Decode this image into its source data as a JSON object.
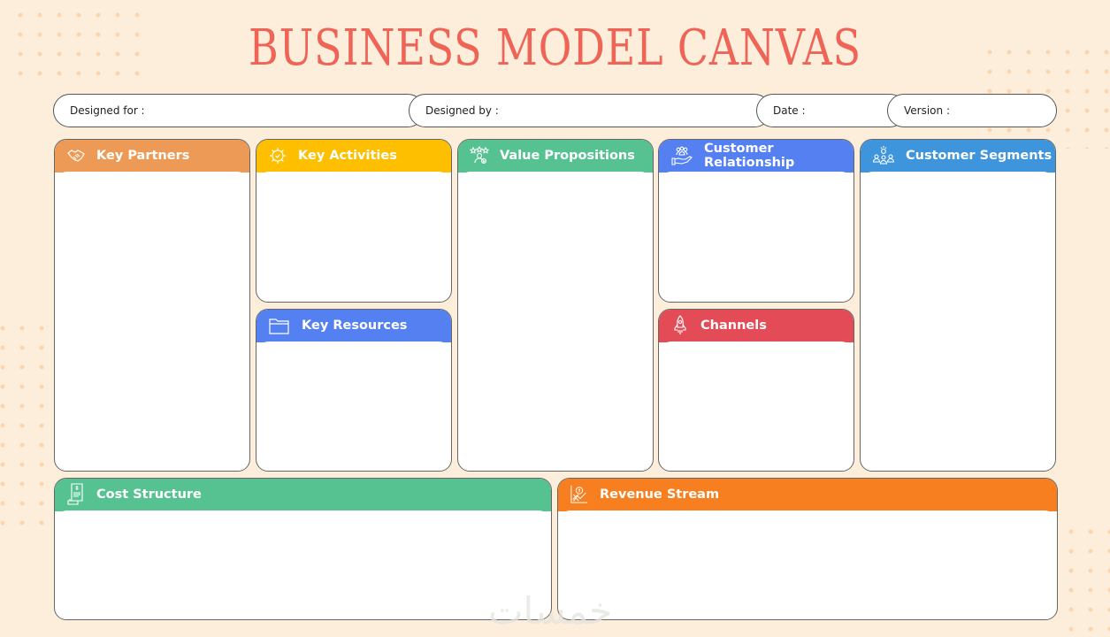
{
  "title": "BUSINESS MODEL CANVAS",
  "meta_fields": [
    {
      "label": "Designed for :",
      "value": ""
    },
    {
      "label": "Designed by :",
      "value": ""
    },
    {
      "label": "Date :",
      "value": ""
    },
    {
      "label": "Version :",
      "value": ""
    }
  ],
  "blocks": {
    "key_partners": {
      "label": "Key Partners",
      "icon": "handshake-icon",
      "color": "#ec9a55"
    },
    "key_activities": {
      "label": "Key Activities",
      "icon": "gear-check-icon",
      "color": "#fdbf00"
    },
    "key_resources": {
      "label": "Key Resources",
      "icon": "folder-icon",
      "color": "#5580f1"
    },
    "value_propositions": {
      "label": "Value Propositions",
      "icon": "user-stars-icon",
      "color": "#57c291"
    },
    "customer_relationship": {
      "label": "Customer Relationship",
      "icon": "hand-people-icon",
      "color": "#5580f1"
    },
    "channels": {
      "label": "Channels",
      "icon": "rocket-icon",
      "color": "#e34c57"
    },
    "customer_segments": {
      "label": "Customer Segments",
      "icon": "people-idea-icon",
      "color": "#3e95dc"
    },
    "cost_structure": {
      "label": "Cost Structure",
      "icon": "receipt-icon",
      "color": "#57c291"
    },
    "revenue_stream": {
      "label": "Revenue Stream",
      "icon": "coin-chart-icon",
      "color": "#f77f1f"
    }
  },
  "watermark": "خمسات"
}
